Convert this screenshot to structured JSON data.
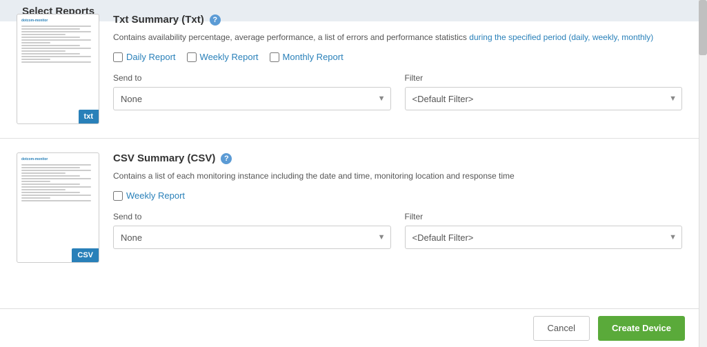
{
  "page": {
    "title": "Select Reports"
  },
  "reports": [
    {
      "id": "txt-summary",
      "title": "Txt Summary (Txt)",
      "description_prefix": "Contains availability percentage, average performance, a list of errors and performance statistics",
      "description_link": "during the specified period (daily, weekly, monthly)",
      "checkboxes": [
        {
          "id": "daily-report-1",
          "label": "Daily Report",
          "checked": false
        },
        {
          "id": "weekly-report-1",
          "label": "Weekly Report",
          "checked": false
        },
        {
          "id": "monthly-report-1",
          "label": "Monthly Report",
          "checked": false
        }
      ],
      "send_to_label": "Send to",
      "send_to_value": "None",
      "filter_label": "Filter",
      "filter_value": "<Default Filter>",
      "badge": "txt"
    },
    {
      "id": "csv-summary",
      "title": "CSV Summary (CSV)",
      "description_prefix": "Contains a list of each monitoring instance including the date and time, monitoring location and response time",
      "description_link": "",
      "checkboxes": [
        {
          "id": "weekly-report-2",
          "label": "Weekly Report",
          "checked": false
        }
      ],
      "send_to_label": "Send to",
      "send_to_value": "None",
      "filter_label": "Filter",
      "filter_value": "<Default Filter>",
      "badge": "CSV"
    }
  ],
  "footer": {
    "cancel_label": "Cancel",
    "create_label": "Create Device"
  }
}
